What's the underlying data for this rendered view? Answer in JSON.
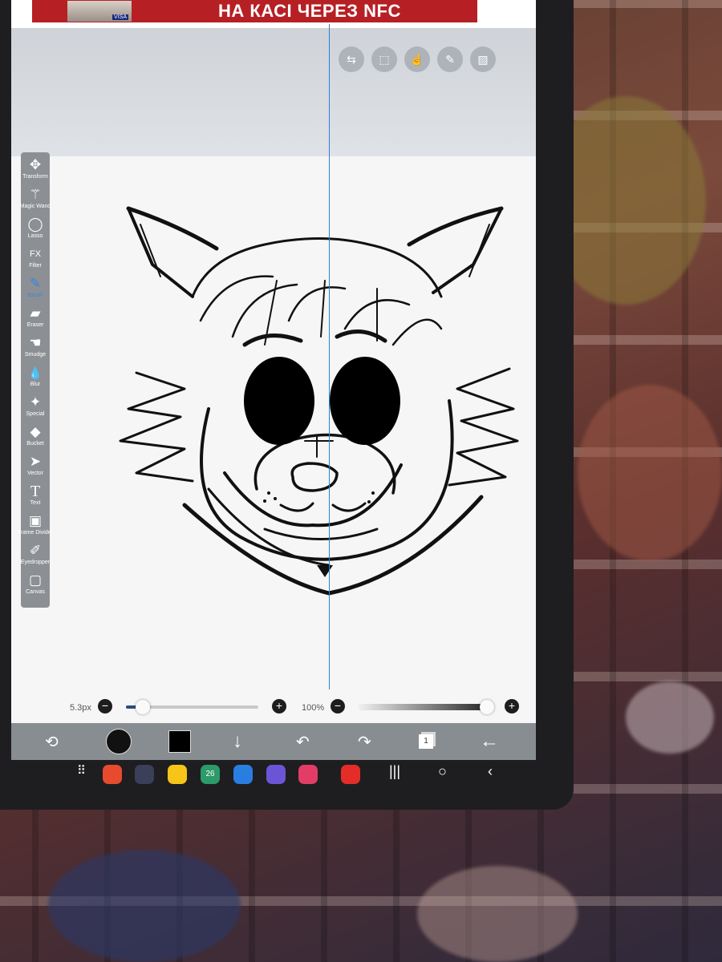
{
  "ad": {
    "text": "НА КАСІ ЧЕРЕЗ NFC",
    "card_text": "VISA"
  },
  "top_icons": [
    "toggle-icon",
    "selection-icon",
    "gesture-icon",
    "pen-icon",
    "image-icon"
  ],
  "tools": [
    {
      "label": "Transform",
      "icon": "✥"
    },
    {
      "label": "Magic Wand",
      "icon": "⚚"
    },
    {
      "label": "Lasso",
      "icon": "◯"
    },
    {
      "label": "Filter",
      "icon": "FX"
    },
    {
      "label": "Brush",
      "icon": "✎",
      "active": true
    },
    {
      "label": "Eraser",
      "icon": "▰"
    },
    {
      "label": "Smudge",
      "icon": "☚"
    },
    {
      "label": "Blur",
      "icon": "💧"
    },
    {
      "label": "Special",
      "icon": "✦"
    },
    {
      "label": "Bucket",
      "icon": "◆"
    },
    {
      "label": "Vector",
      "icon": "➤"
    },
    {
      "label": "Text",
      "icon": "T"
    },
    {
      "label": "Frame Divider",
      "icon": "▣"
    },
    {
      "label": "Eyedropper",
      "icon": "✐"
    },
    {
      "label": "Canvas",
      "icon": "▢"
    }
  ],
  "brush_size": {
    "value": "5.3px",
    "level": 0.07
  },
  "opacity": {
    "value": "100%",
    "level": 1.0
  },
  "minus": "−",
  "plus": "+",
  "bottom_tools": {
    "layer_count": "1"
  },
  "colors": {
    "primary_color": "#000000",
    "accent": "#3a86d8",
    "guide": "#2d7fd3"
  },
  "nav_apps": [
    "calendar-app-icon",
    "26"
  ]
}
